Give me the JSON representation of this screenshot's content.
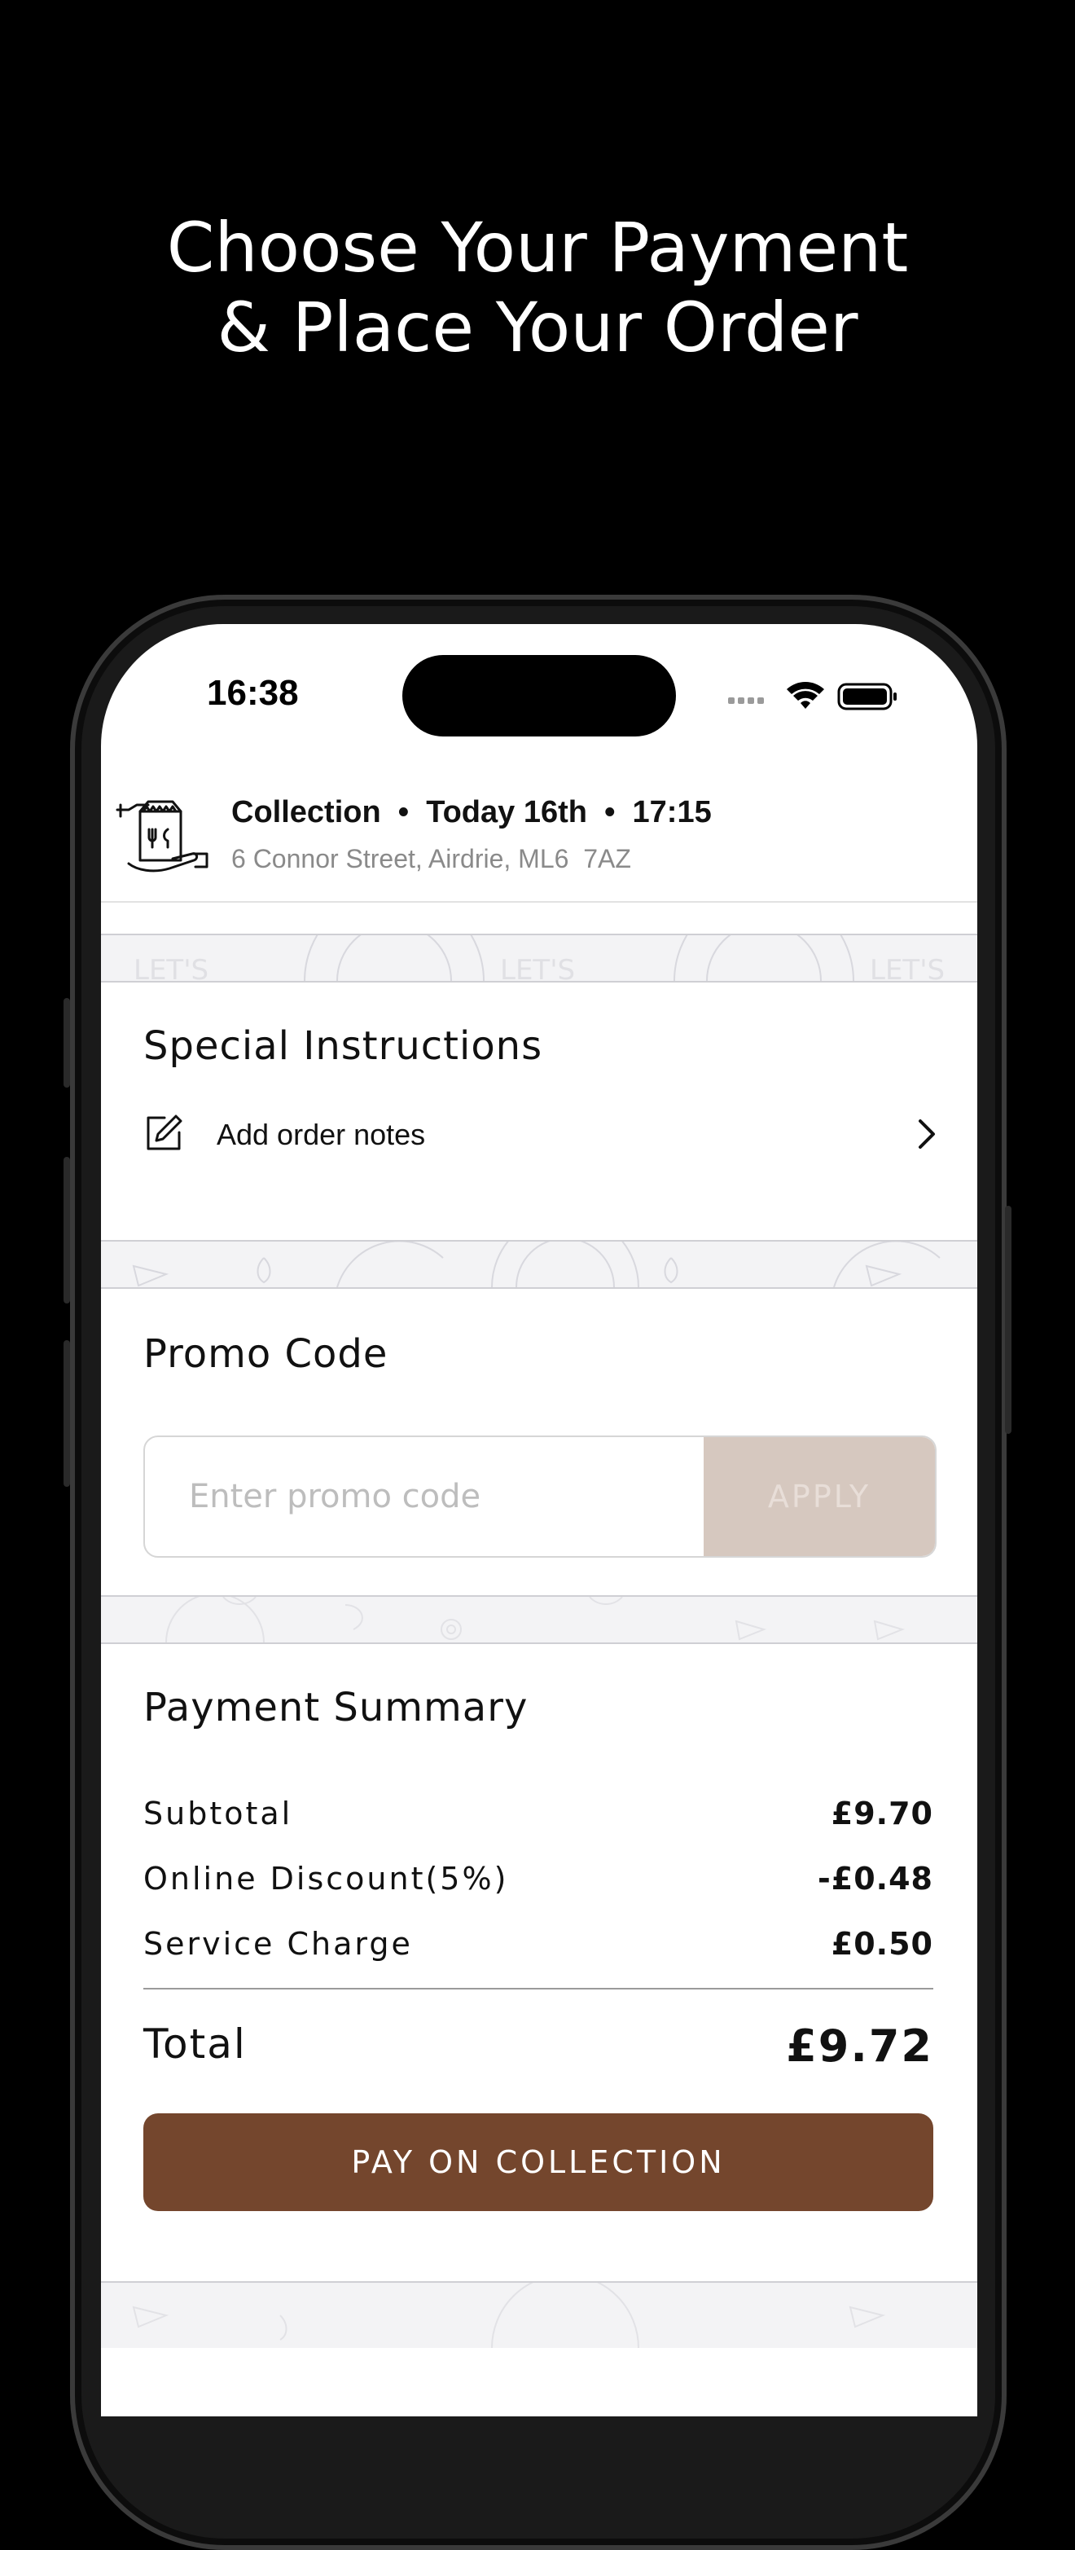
{
  "headline": {
    "line1": "Choose Your Payment",
    "line2": "& Place Your Order"
  },
  "status_bar": {
    "time": "16:38",
    "icons": [
      "signal-icon",
      "wifi-icon",
      "battery-icon"
    ]
  },
  "collection": {
    "summary": "Collection  •  Today 16th  •  17:15",
    "address": "6 Connor Street, Airdrie, ML6  7AZ",
    "icon": "collection-bag-icon"
  },
  "special_instructions": {
    "title": "Special Instructions",
    "row_label": "Add order notes",
    "icon": "edit-icon",
    "chevron": "chevron-right-icon"
  },
  "promo": {
    "title": "Promo Code",
    "placeholder": "Enter promo code",
    "value": "",
    "apply_label": "APPLY"
  },
  "payment_summary": {
    "title": "Payment Summary",
    "rows": [
      {
        "label": "Subtotal",
        "value": "£9.70"
      },
      {
        "label": "Online Discount(5%)",
        "value": "-£0.48"
      },
      {
        "label": "Service Charge",
        "value": "£0.50"
      }
    ],
    "total_label": "Total",
    "total_value": "£9.72",
    "pay_label": "PAY ON COLLECTION"
  },
  "colors": {
    "accent_brown": "#74462d",
    "apply_disabled": "#d6c8bf",
    "background": "#000000"
  }
}
